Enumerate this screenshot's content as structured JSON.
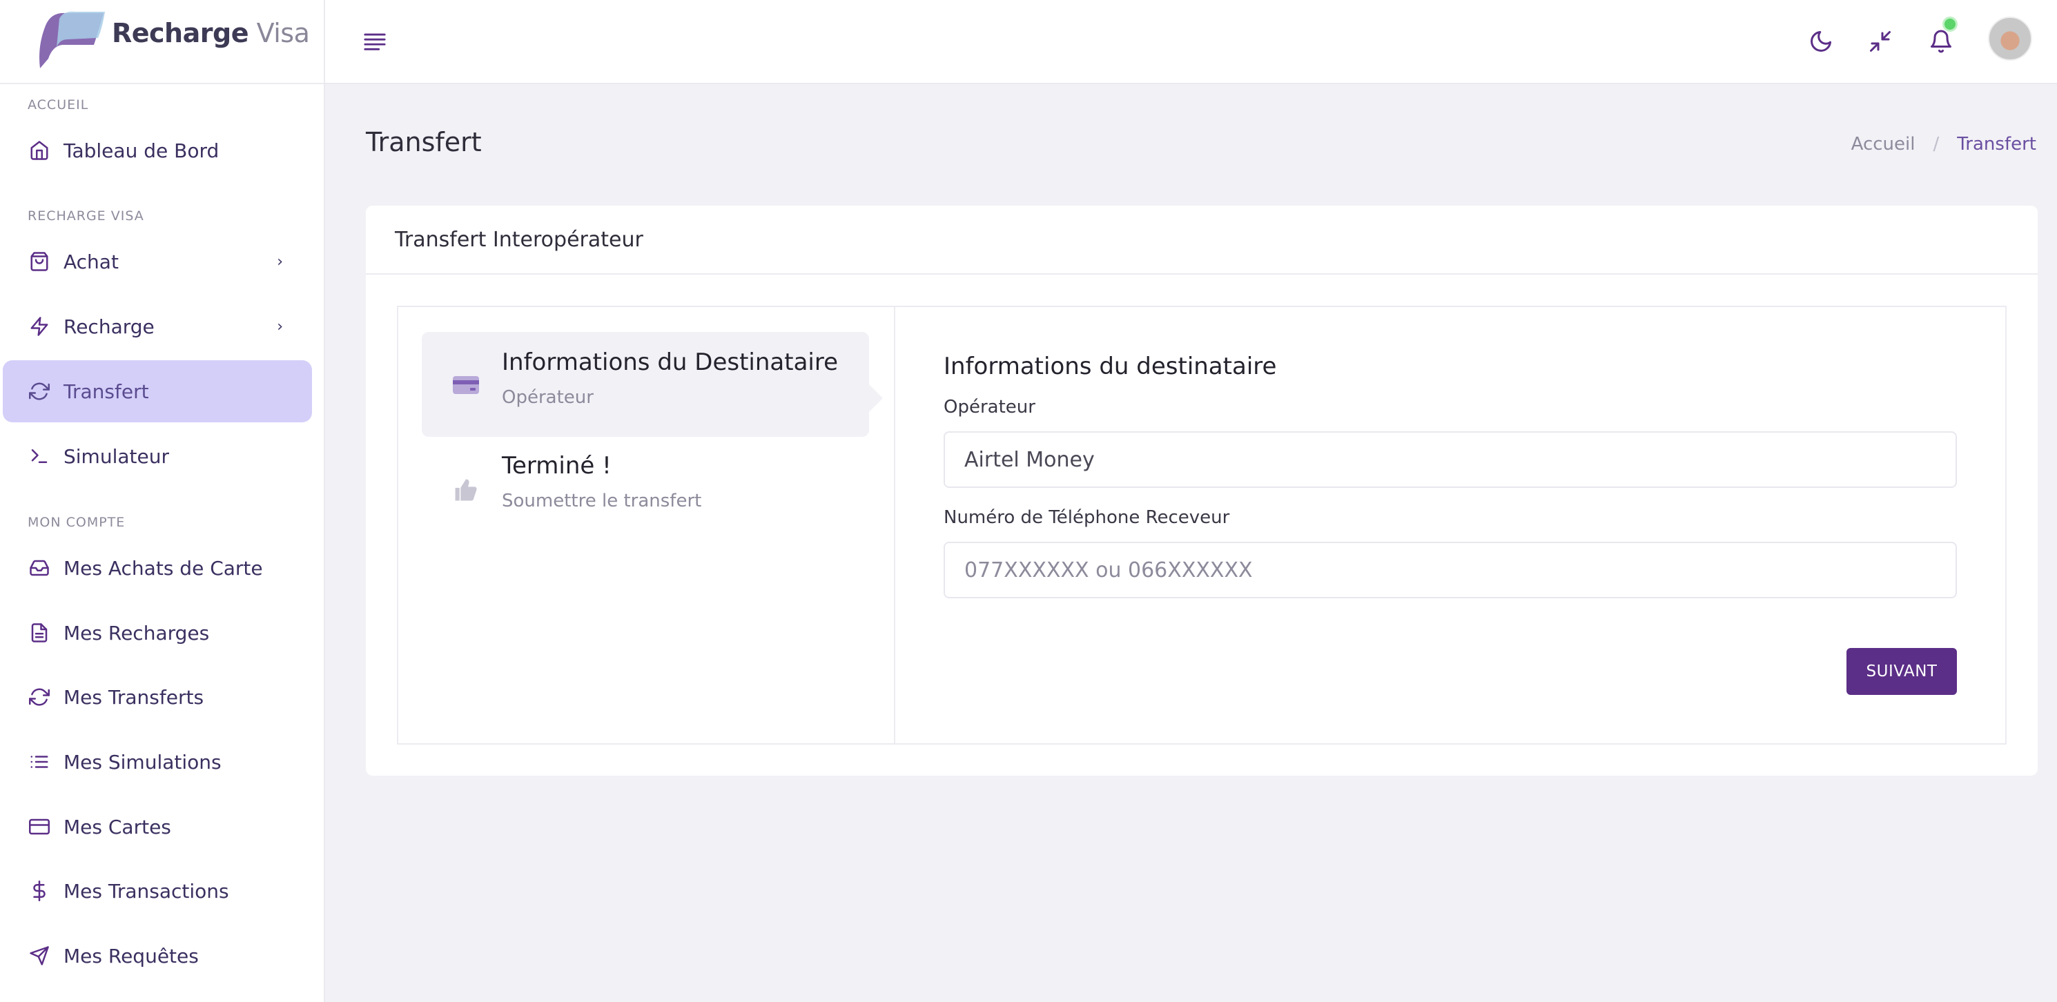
{
  "brand": {
    "name_bold": "Recharge",
    "name_light": "Visa"
  },
  "colors": {
    "accent": "#5b2e87",
    "active_bg": "#d4cff9",
    "icon": "#5b2e87"
  },
  "sidebar": {
    "sections": [
      "ACCUEIL",
      "RECHARGE VISA",
      "MON COMPTE"
    ],
    "items": [
      {
        "label": "Tableau de Bord",
        "icon": "home-icon"
      },
      {
        "label": "Achat",
        "icon": "shopping-bag-icon"
      },
      {
        "label": "Recharge",
        "icon": "zap-icon"
      },
      {
        "label": "Transfert",
        "icon": "refresh-icon"
      },
      {
        "label": "Simulateur",
        "icon": "terminal-icon"
      },
      {
        "label": "Mes Achats de Carte",
        "icon": "inbox-icon"
      },
      {
        "label": "Mes Recharges",
        "icon": "file-text-icon"
      },
      {
        "label": "Mes Transferts",
        "icon": "refresh-icon"
      },
      {
        "label": "Mes Simulations",
        "icon": "list-icon"
      },
      {
        "label": "Mes Cartes",
        "icon": "credit-card-icon"
      },
      {
        "label": "Mes Transactions",
        "icon": "dollar-icon"
      },
      {
        "label": "Mes Requêtes",
        "icon": "send-icon"
      }
    ]
  },
  "page": {
    "title": "Transfert"
  },
  "breadcrumb": {
    "home": "Accueil",
    "current": "Transfert"
  },
  "card": {
    "title": "Transfert Interopérateur"
  },
  "steps": [
    {
      "title": "Informations du Destinataire",
      "subtitle": "Opérateur",
      "icon": "credit-card-icon"
    },
    {
      "title": "Terminé !",
      "subtitle": "Soumettre le transfert",
      "icon": "thumbs-up-icon"
    }
  ],
  "form": {
    "heading": "Informations du destinataire",
    "operator_label": "Opérateur",
    "operator_value": "Airtel Money",
    "phone_label": "Numéro de Téléphone Receveur",
    "phone_placeholder": "077XXXXXX ou 066XXXXXX",
    "next_button": "SUIVANT"
  }
}
